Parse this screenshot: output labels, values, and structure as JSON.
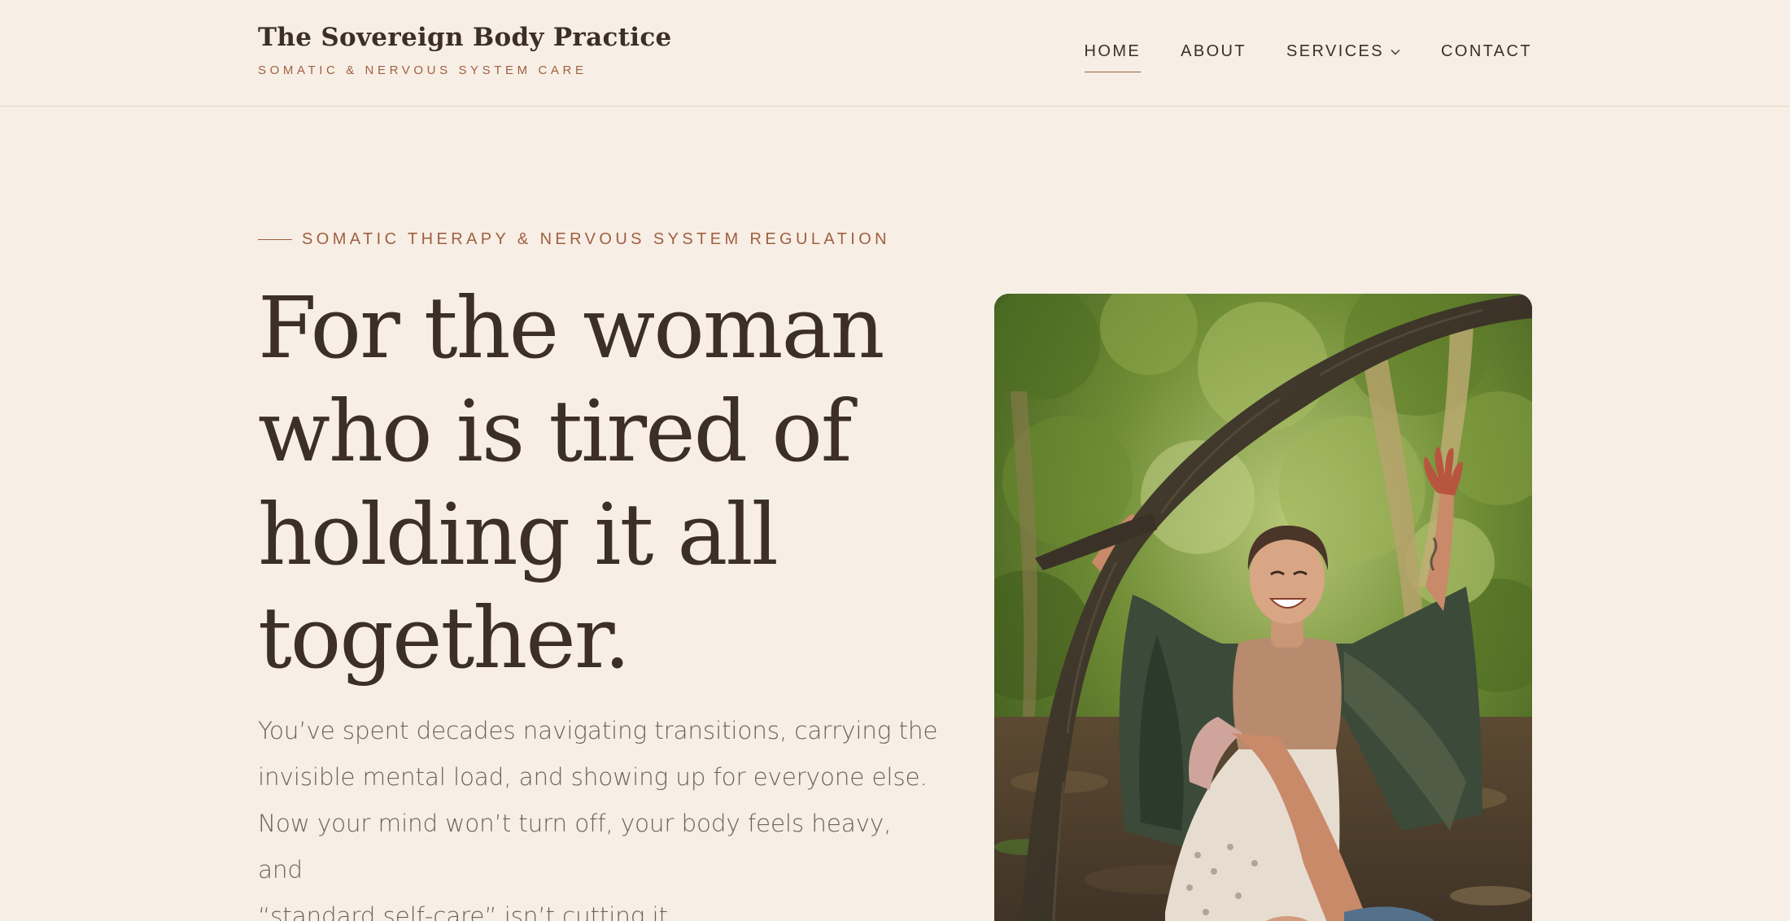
{
  "header": {
    "brand_title": "The Sovereign Body Practice",
    "brand_tagline": "SOMATIC & NERVOUS SYSTEM CARE",
    "nav": [
      {
        "label": "HOME",
        "active": true
      },
      {
        "label": "ABOUT",
        "active": false
      },
      {
        "label": "SERVICES",
        "active": false,
        "has_dropdown": true
      },
      {
        "label": "CONTACT",
        "active": false
      }
    ]
  },
  "hero": {
    "eyebrow": "SOMATIC THERAPY & NERVOUS SYSTEM REGULATION",
    "heading_lines": [
      "For the woman",
      "who is tired of",
      "holding it all",
      "together."
    ],
    "body_lines": [
      "You’ve spent decades navigating transitions, carrying the",
      "invisible mental load, and showing up for everyone else.",
      "Now your mind won’t turn off, your body feels heavy, and",
      "“standard self-care” isn’t cutting it."
    ],
    "image_subject": "woman-laughing-in-forest-photo"
  },
  "colors": {
    "background": "#f7efe5",
    "text": "#3b2f28",
    "accent": "#a05f41",
    "muted_text": "#6e625b",
    "divider": "#e6d5c4"
  },
  "icons": {
    "services_dropdown": "chevron-down-icon"
  }
}
